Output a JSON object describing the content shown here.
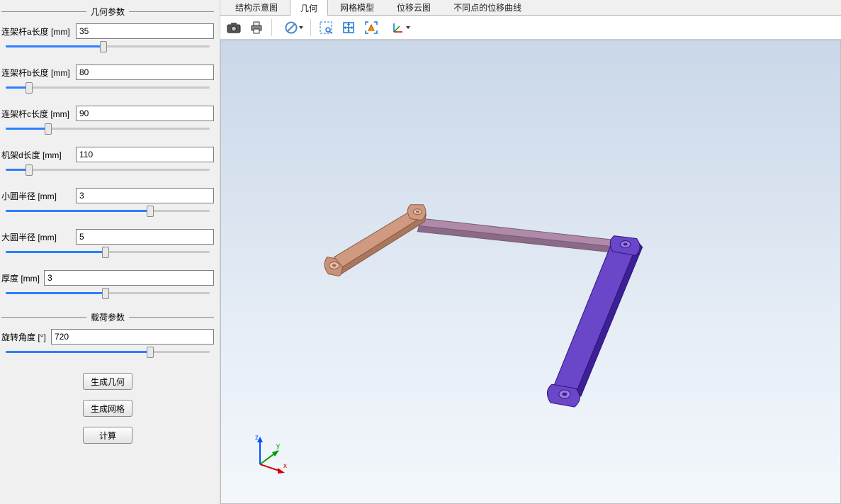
{
  "sections": {
    "geom_title": "几何参数",
    "load_title": "载荷参数"
  },
  "params": {
    "a": {
      "label": "连架杆a长度 [mm]",
      "value": "35",
      "pct": 48
    },
    "b": {
      "label": "连架杆b长度 [mm]",
      "value": "80",
      "pct": 13
    },
    "c": {
      "label": "连架杆c长度 [mm]",
      "value": "90",
      "pct": 22
    },
    "d": {
      "label": "机架d长度 [mm]",
      "value": "110",
      "pct": 13
    },
    "sr": {
      "label": "小圆半径 [mm]",
      "value": "3",
      "pct": 70
    },
    "br": {
      "label": "大圆半径 [mm]",
      "value": "5",
      "pct": 49
    },
    "th": {
      "label": "厚度 [mm]",
      "value": "3",
      "pct": 49
    },
    "rot": {
      "label": "旋转角度 [°]",
      "value": "720",
      "pct": 70
    }
  },
  "buttons": {
    "gen_geom": "生成几何",
    "gen_mesh": "生成网格",
    "compute": "计算"
  },
  "tabs": {
    "t1": "结构示意图",
    "t2": "几何",
    "t3": "网格模型",
    "t4": "位移云图",
    "t5": "不同点的位移曲线"
  },
  "triad": {
    "x": "x",
    "y": "y",
    "z": "z"
  },
  "colors": {
    "link1": "#c99176",
    "link1_edge": "#8a5a42",
    "link2": "#b08aa9",
    "link2_edge": "#7a5a78",
    "link3": "#5431b0",
    "link3_edge": "#2e1576"
  }
}
